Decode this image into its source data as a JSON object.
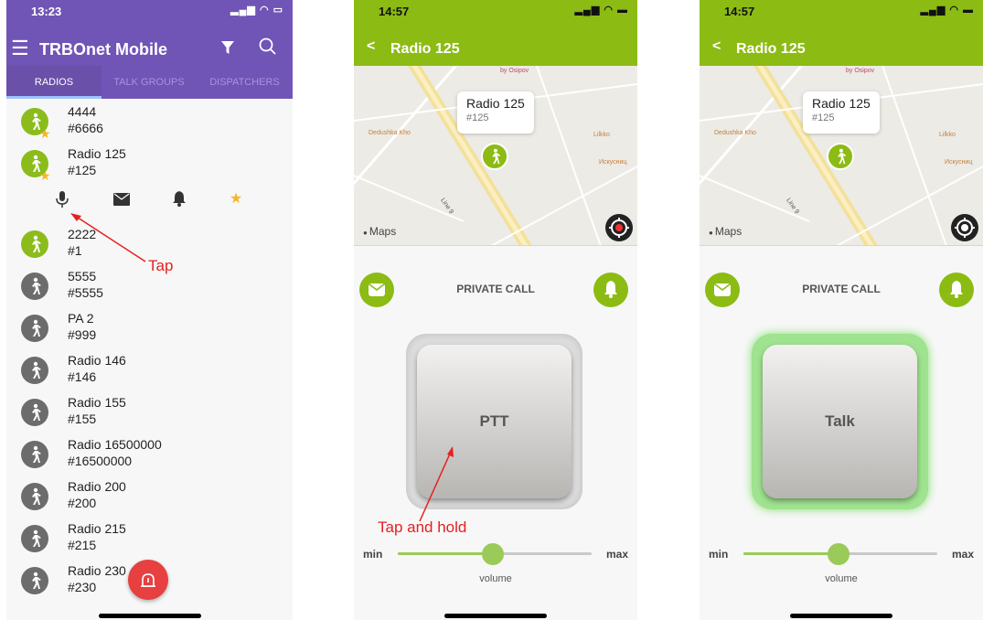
{
  "list_screen": {
    "status": {
      "time": "13:23"
    },
    "app_title": "TRBOnet Mobile",
    "tabs": [
      {
        "label": "RADIOS",
        "active": true
      },
      {
        "label": "TALK GROUPS",
        "active": false
      },
      {
        "label": "DISPATCHERS",
        "active": false
      }
    ],
    "radios": [
      {
        "name": "4444",
        "id": "#6666",
        "online": true,
        "favorite": true
      },
      {
        "name": "Radio 125",
        "id": "#125",
        "online": true,
        "favorite": true
      },
      {
        "name": "2222",
        "id": "#1",
        "online": true,
        "favorite": false
      },
      {
        "name": "5555",
        "id": "#5555",
        "online": false,
        "favorite": false
      },
      {
        "name": "PA 2",
        "id": "#999",
        "online": false,
        "favorite": false
      },
      {
        "name": "Radio 146",
        "id": "#146",
        "online": false,
        "favorite": false
      },
      {
        "name": "Radio 155",
        "id": "#155",
        "online": false,
        "favorite": false
      },
      {
        "name": "Radio 16500000",
        "id": "#16500000",
        "online": false,
        "favorite": false
      },
      {
        "name": "Radio 200",
        "id": "#200",
        "online": false,
        "favorite": false
      },
      {
        "name": "Radio 215",
        "id": "#215",
        "online": false,
        "favorite": false
      },
      {
        "name": "Radio 230",
        "id": "#230",
        "online": false,
        "favorite": false
      }
    ],
    "action_icons": [
      "microphone-icon",
      "envelope-icon",
      "bell-icon",
      "star-icon"
    ],
    "annotation": "Tap"
  },
  "detail_screens": [
    {
      "status": {
        "time": "14:57"
      },
      "title": "Radio 125",
      "map": {
        "callout_name": "Radio 125",
        "callout_id": "#125",
        "pois": [
          "Dedushka Kho",
          "Lilkko",
          "Искусниц",
          "Line 9",
          "by Osipov"
        ],
        "attribution": "Maps"
      },
      "call_type": "PRIVATE CALL",
      "button_label": "PTT",
      "button_active": false,
      "volume": {
        "min_label": "min",
        "max_label": "max",
        "label": "volume",
        "level": 0.49
      },
      "annotation": "Tap and hold"
    },
    {
      "status": {
        "time": "14:57"
      },
      "title": "Radio 125",
      "map": {
        "callout_name": "Radio 125",
        "callout_id": "#125",
        "pois": [
          "Dedushka Kho",
          "Lilkko",
          "Искусниц",
          "Line 9",
          "by Osipov"
        ],
        "attribution": "Maps"
      },
      "call_type": "PRIVATE CALL",
      "button_label": "Talk",
      "button_active": true,
      "volume": {
        "min_label": "min",
        "max_label": "max",
        "label": "volume",
        "level": 0.49
      },
      "annotation": ""
    }
  ],
  "colors": {
    "purple": "#7054b6",
    "green": "#8cbb14",
    "offline_gray": "#6c6c6c",
    "alert_red": "#e52020",
    "star_yellow": "#f5b728"
  }
}
